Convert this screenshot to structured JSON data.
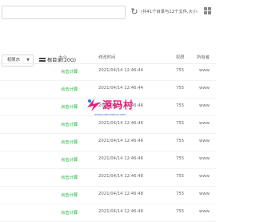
{
  "toolbar": {
    "search_placeholder": "",
    "refresh_icon": "refresh-icon",
    "summary": "(共41个目录与12个文件,大小:",
    "grid_icon": "grid-view-icon"
  },
  "pathbar": {
    "view_label": "权限示",
    "disk_icon": "disk-icon",
    "root_label": "根目录(20G)"
  },
  "table": {
    "columns": {
      "size": "大小",
      "mtime": "修改时间",
      "perm": "权限",
      "owner": "所有者"
    },
    "rows": [
      {
        "size": "点击计算",
        "mtime": "2021/04/14 12:46:44",
        "perm": "755",
        "owner": "www"
      },
      {
        "size": "点击计算",
        "mtime": "2021/04/14 12:46:44",
        "perm": "755",
        "owner": "www"
      },
      {
        "size": "点击计算",
        "mtime": "2021/04/14 12:46:46",
        "perm": "755",
        "owner": "www"
      },
      {
        "size": "点击计算",
        "mtime": "2021/04/14 12:46:46",
        "perm": "755",
        "owner": "www"
      },
      {
        "size": "点击计算",
        "mtime": "2021/04/14 12:46:46",
        "perm": "755",
        "owner": "www"
      },
      {
        "size": "点击计算",
        "mtime": "2021/04/14 12:46:46",
        "perm": "755",
        "owner": "www"
      },
      {
        "size": "点击计算",
        "mtime": "2021/04/14 12:46:48",
        "perm": "755",
        "owner": "www"
      },
      {
        "size": "点击计算",
        "mtime": "2021/04/14 12:46:48",
        "perm": "755",
        "owner": "www"
      },
      {
        "size": "点击计算",
        "mtime": "2021/04/14 12:46:48",
        "perm": "755",
        "owner": "www"
      }
    ]
  },
  "watermark": {
    "title": "源码村",
    "url": "www.yuanmacun.com"
  },
  "colors": {
    "accent": "#20a53a",
    "watermark": "#e0207a"
  }
}
